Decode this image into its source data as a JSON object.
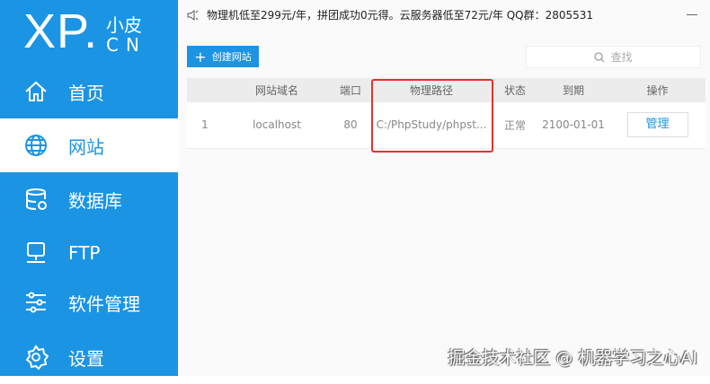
{
  "logo": {
    "main": "XP.",
    "small": "小皮",
    "cn": "CN"
  },
  "nav": [
    {
      "label": "首页",
      "icon": "home-icon"
    },
    {
      "label": "网站",
      "icon": "globe-icon"
    },
    {
      "label": "数据库",
      "icon": "database-icon"
    },
    {
      "label": "FTP",
      "icon": "ftp-server-icon"
    },
    {
      "label": "软件管理",
      "icon": "sliders-icon"
    },
    {
      "label": "设置",
      "icon": "gear-icon"
    }
  ],
  "notice": "物理机低至299元/年，拼团成功0元得。云服务器低至72元/年  QQ群：2805531",
  "toolbar": {
    "create_label": "创建网站",
    "search_placeholder": "查找"
  },
  "table": {
    "headers": [
      "",
      "网站域名",
      "端口",
      "物理路径",
      "状态",
      "到期",
      "操作"
    ],
    "rows": [
      {
        "index": "1",
        "domain": "localhost",
        "port": "80",
        "path": "C:/PhpStudy/phpst...",
        "status": "正常",
        "expiry": "2100-01-01",
        "action": "管理"
      }
    ]
  },
  "watermark": "掘金技术社区 @ 机器学习之心AI"
}
